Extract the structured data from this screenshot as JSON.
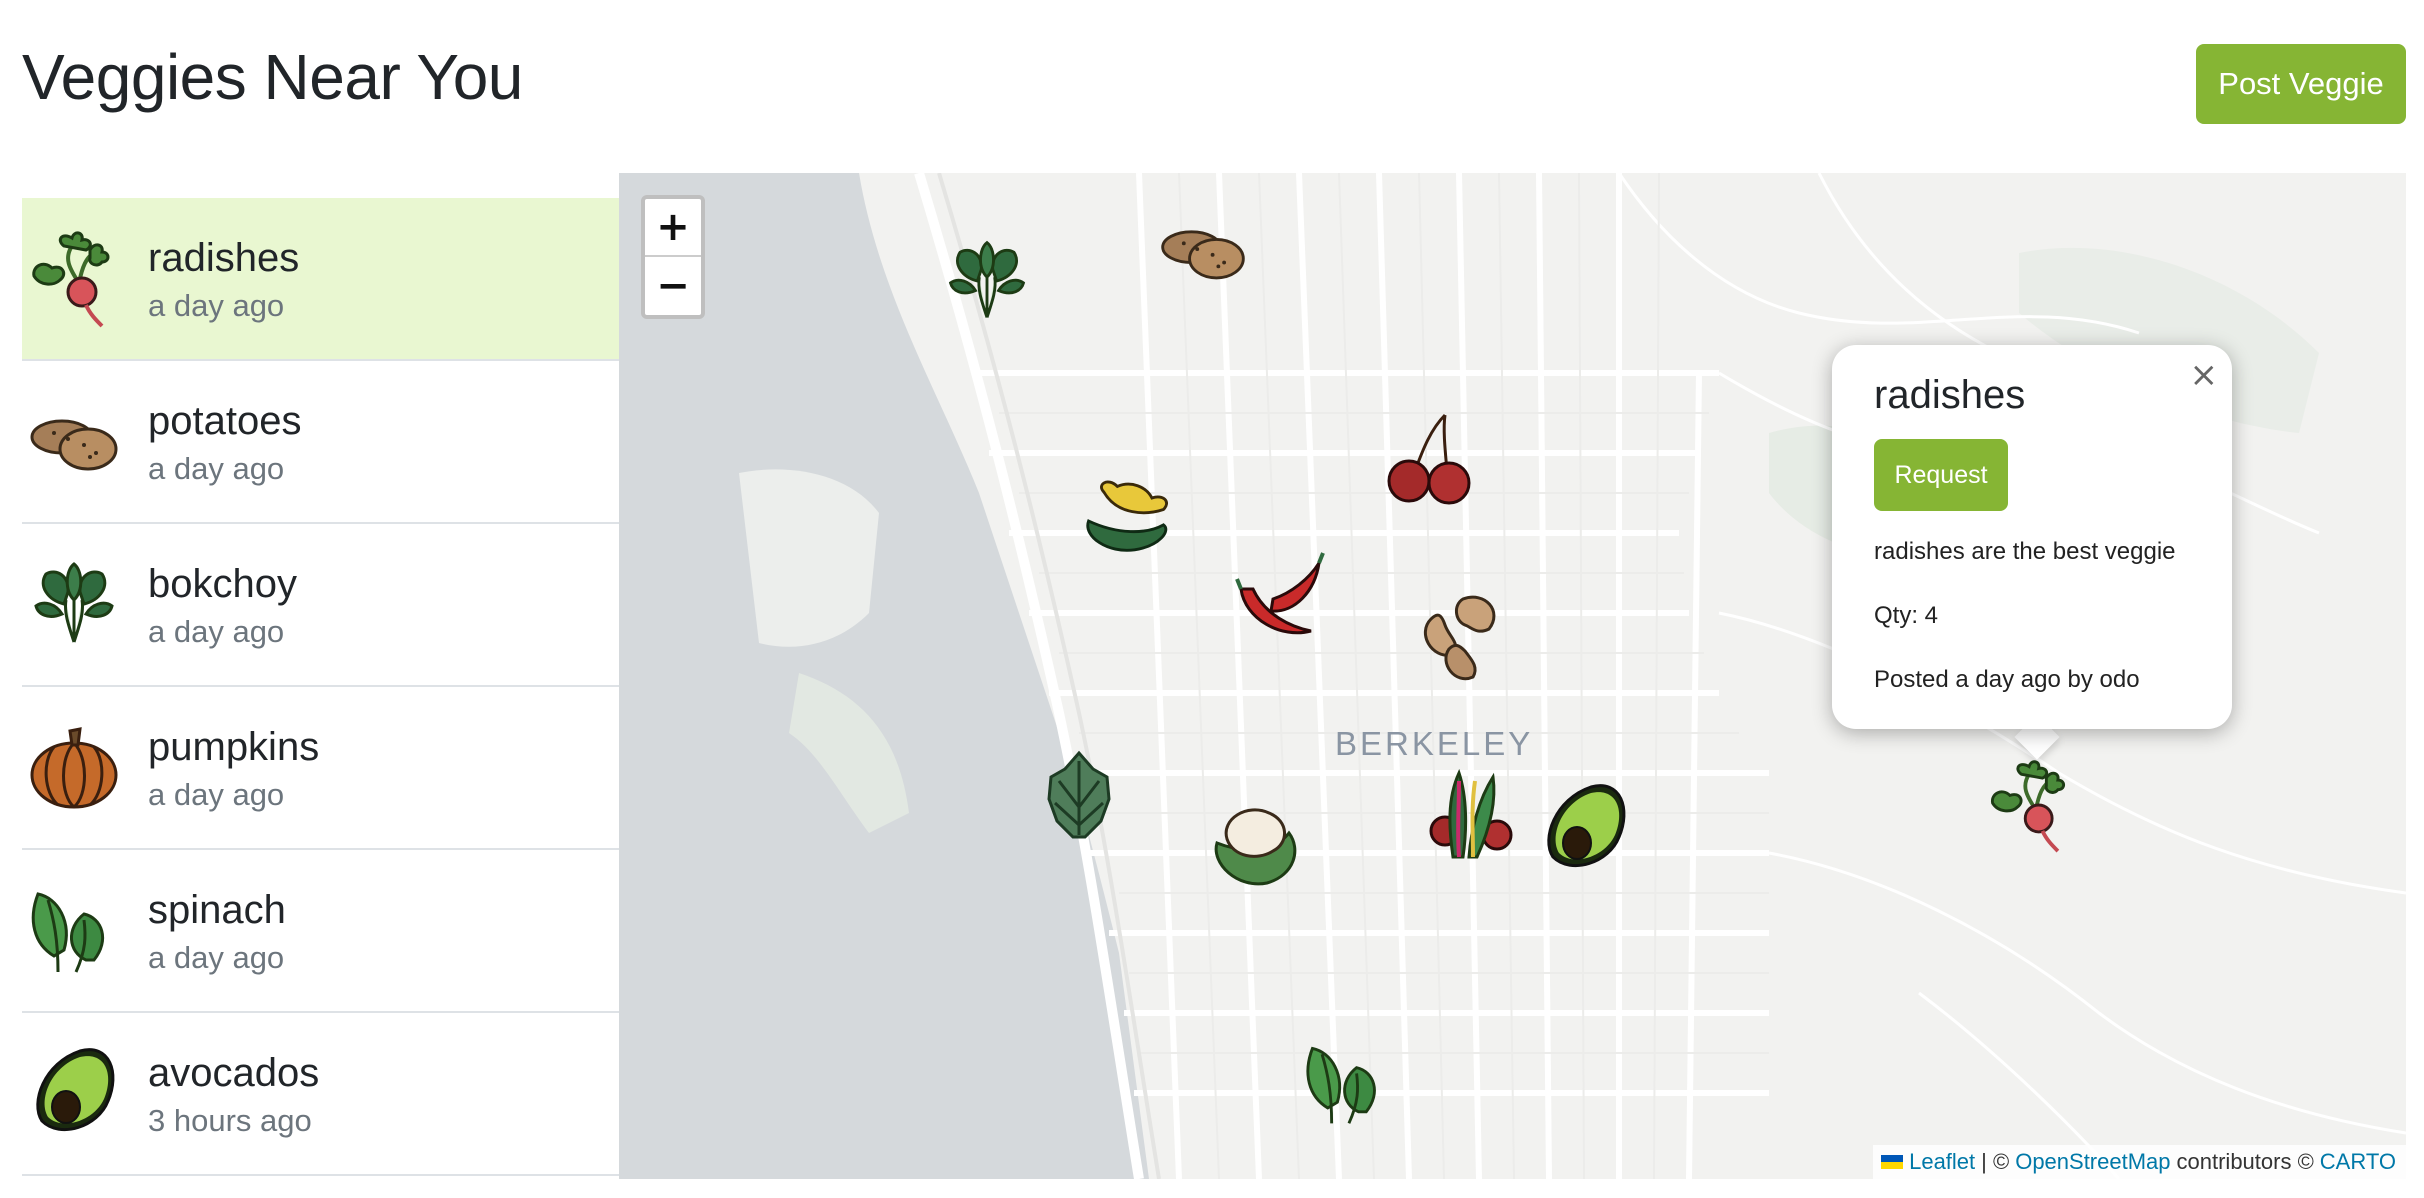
{
  "header": {
    "title": "Veggies Near You",
    "post_button": "Post Veggie"
  },
  "sidebar": {
    "items": [
      {
        "name": "radishes",
        "time": "a day ago",
        "icon": "radish-icon",
        "active": true
      },
      {
        "name": "potatoes",
        "time": "a day ago",
        "icon": "potato-icon",
        "active": false
      },
      {
        "name": "bokchoy",
        "time": "a day ago",
        "icon": "bokchoy-icon",
        "active": false
      },
      {
        "name": "pumpkins",
        "time": "a day ago",
        "icon": "pumpkin-icon",
        "active": false
      },
      {
        "name": "spinach",
        "time": "a day ago",
        "icon": "spinach-icon",
        "active": false
      },
      {
        "name": "avocados",
        "time": "3 hours ago",
        "icon": "avocado-icon",
        "active": false
      }
    ]
  },
  "map": {
    "zoom_in": "+",
    "zoom_out": "−",
    "city_label": "BERKELEY",
    "popup": {
      "title": "radishes",
      "request_button": "Request",
      "description": "radishes are the best veggie",
      "quantity": "Qty: 4",
      "posted": "Posted a day ago by odo",
      "close": "×"
    },
    "attribution": {
      "leaflet": "Leaflet",
      "separator": "| ©",
      "osm": "OpenStreetMap",
      "contributors": "contributors ©",
      "carto": "CARTO"
    }
  },
  "colors": {
    "accent": "#86b534",
    "active_row": "#e9f7d1",
    "link": "#0078a8"
  }
}
